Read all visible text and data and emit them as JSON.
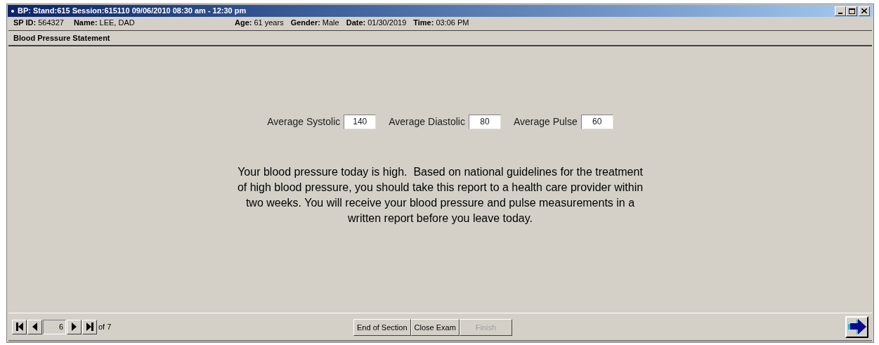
{
  "window": {
    "title": "BP: Stand:615 Session:615110 09/06/2010 08:30 am - 12:30 pm"
  },
  "info_left": [
    {
      "label": "SP ID:",
      "value": "564327"
    },
    {
      "label": "Name:",
      "value": "LEE, DAD"
    }
  ],
  "info_right": [
    {
      "label": "Age:",
      "value": "61 years"
    },
    {
      "label": "Gender:",
      "value": "Male"
    },
    {
      "label": "Date:",
      "value": "01/30/2019"
    },
    {
      "label": "Time:",
      "value": "03:06 PM"
    }
  ],
  "section_title": "Blood Pressure Statement",
  "measurements": [
    {
      "label": "Average Systolic",
      "value": "140"
    },
    {
      "label": "Average Diastolic",
      "value": "80"
    },
    {
      "label": "Average Pulse",
      "value": "60"
    }
  ],
  "statement": "Your blood pressure today is high.  Based on national guidelines for the treatment of high blood pressure, you should take this report to a health care provider within two weeks. You will receive your blood pressure and pulse measurements in a written report before you leave today.",
  "pager": {
    "page": "6",
    "of": "of 7"
  },
  "buttons": [
    {
      "label": "End of Section",
      "disabled": false
    },
    {
      "label": "Close Exam",
      "disabled": false
    },
    {
      "label": "Finish",
      "disabled": true
    }
  ]
}
